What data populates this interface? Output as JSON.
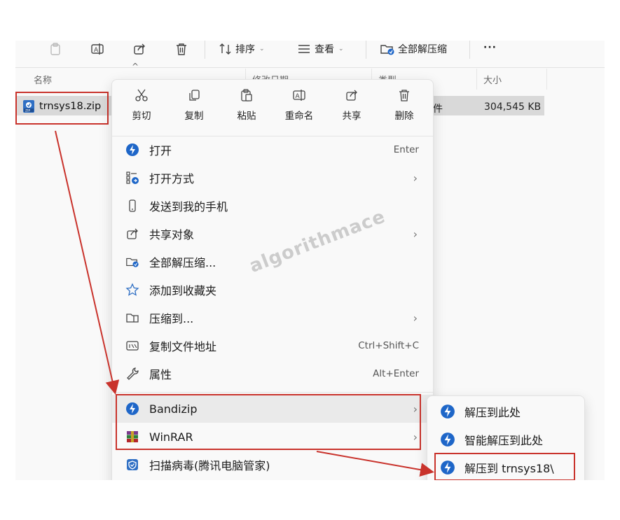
{
  "toolbar": {
    "sort_label": "排序",
    "view_label": "查看",
    "extract_all_label": "全部解压缩",
    "more_label": "···"
  },
  "columns": {
    "name": "名称",
    "date": "修改日期",
    "type": "类型",
    "size": "大小"
  },
  "file": {
    "name": "trnsys18.zip",
    "type_partial": "件",
    "size": "304,545 KB"
  },
  "quick_actions": [
    {
      "label": "剪切",
      "icon": "scissors-icon"
    },
    {
      "label": "复制",
      "icon": "copy-icon"
    },
    {
      "label": "粘贴",
      "icon": "paste-icon"
    },
    {
      "label": "重命名",
      "icon": "rename-icon"
    },
    {
      "label": "共享",
      "icon": "share-icon"
    },
    {
      "label": "删除",
      "icon": "trash-icon"
    }
  ],
  "menu_items": [
    {
      "label": "打开",
      "shortcut": "Enter",
      "icon": "bandizip-icon"
    },
    {
      "label": "打开方式",
      "shortcut": "",
      "icon": "open-with-icon"
    },
    {
      "label": "发送到我的手机",
      "shortcut": "",
      "icon": "phone-icon"
    },
    {
      "label": "共享对象",
      "shortcut": "",
      "icon": "share-icon"
    },
    {
      "label": "全部解压缩...",
      "shortcut": "",
      "icon": "extract-folder-icon"
    },
    {
      "label": "添加到收藏夹",
      "shortcut": "",
      "icon": "star-icon"
    },
    {
      "label": "压缩到...",
      "shortcut": "",
      "icon": "compress-folder-icon"
    },
    {
      "label": "复制文件地址",
      "shortcut": "Ctrl+Shift+C",
      "icon": "copy-path-icon"
    },
    {
      "label": "属性",
      "shortcut": "Alt+Enter",
      "icon": "wrench-icon"
    },
    {
      "label": "Bandizip",
      "shortcut": "",
      "icon": "bandizip-icon"
    },
    {
      "label": "WinRAR",
      "shortcut": "",
      "icon": "winrar-icon"
    },
    {
      "label": "扫描病毒(腾讯电脑管家)",
      "shortcut": "",
      "icon": "shield-icon"
    }
  ],
  "submenu_items": [
    {
      "label": "解压到此处",
      "icon": "bandizip-icon"
    },
    {
      "label": "智能解压到此处",
      "icon": "bandizip-icon"
    },
    {
      "label": "解压到 trnsys18\\",
      "icon": "bandizip-icon"
    }
  ],
  "watermark": "algorithmace",
  "colors": {
    "highlight_red": "#c9332c",
    "bandizip_blue": "#1e66c8",
    "menu_bg": "#f9f9f9"
  }
}
